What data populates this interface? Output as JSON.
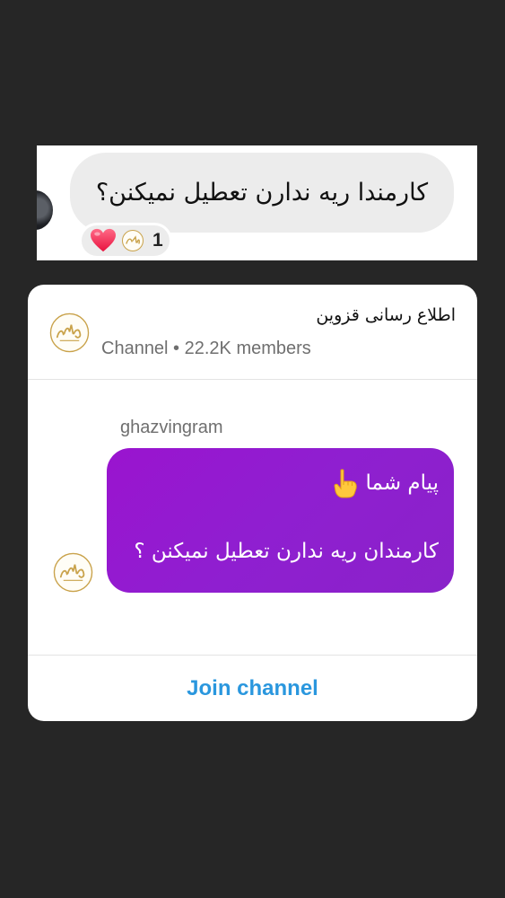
{
  "top_message": {
    "text": "کارمندا ریه ندارن تعطیل نمیکنن؟",
    "reaction_count": "1"
  },
  "channel": {
    "name": "اطلاع رسانی قزوین",
    "meta": "Channel • 22.2K members",
    "logo_icon": "ghazvingram-logo-icon"
  },
  "post": {
    "sender": "ghazvingram",
    "line1": "پیام شما",
    "line2": "کارمندان ریه ندارن تعطیل نمیکنن ؟",
    "bubble_color": "#9a14cf"
  },
  "join_button": {
    "label": "Join channel",
    "color": "#2a97de"
  },
  "colors": {
    "background": "#262626",
    "card": "#ffffff",
    "top_bubble": "#ececec",
    "heart": "#f5335f",
    "logo_gold": "#c9a24a"
  }
}
